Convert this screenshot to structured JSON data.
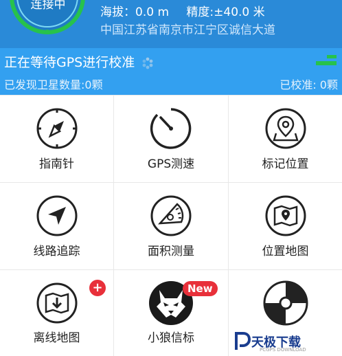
{
  "header": {
    "gauge_text": "连接中",
    "altitude": "海拔：0.0 m",
    "accuracy": "精度:±40.0 米",
    "address": "中国江苏省南京市江宁区诚信大道"
  },
  "status": {
    "title": "正在等待GPS进行校准",
    "satellites": "已发现卫星数量:0颗",
    "calibrated": "已校准: 0颗"
  },
  "grid": {
    "items": [
      {
        "label": "指南针",
        "icon": "compass-icon"
      },
      {
        "label": "GPS测速",
        "icon": "speedometer-icon"
      },
      {
        "label": "标记位置",
        "icon": "map-pin-icon"
      },
      {
        "label": "线路追踪",
        "icon": "navigation-arrow-icon"
      },
      {
        "label": "面积测量",
        "icon": "protractor-icon"
      },
      {
        "label": "位置地图",
        "icon": "map-location-icon"
      },
      {
        "label": "离线地图",
        "icon": "offline-map-icon"
      },
      {
        "label": "小狼信标",
        "icon": "wolf-icon"
      },
      {
        "label": "",
        "icon": "disc-icon"
      }
    ],
    "badge_plus": "+",
    "badge_new": "New"
  },
  "watermark": {
    "text": "天极下载",
    "sub": "PCGPS DOWNLOAD"
  },
  "colors": {
    "header_bg": "#2a8ad8",
    "status_bg": "#33a0f0",
    "badge": "#e8303a",
    "gauge_green": "#27c24c"
  }
}
